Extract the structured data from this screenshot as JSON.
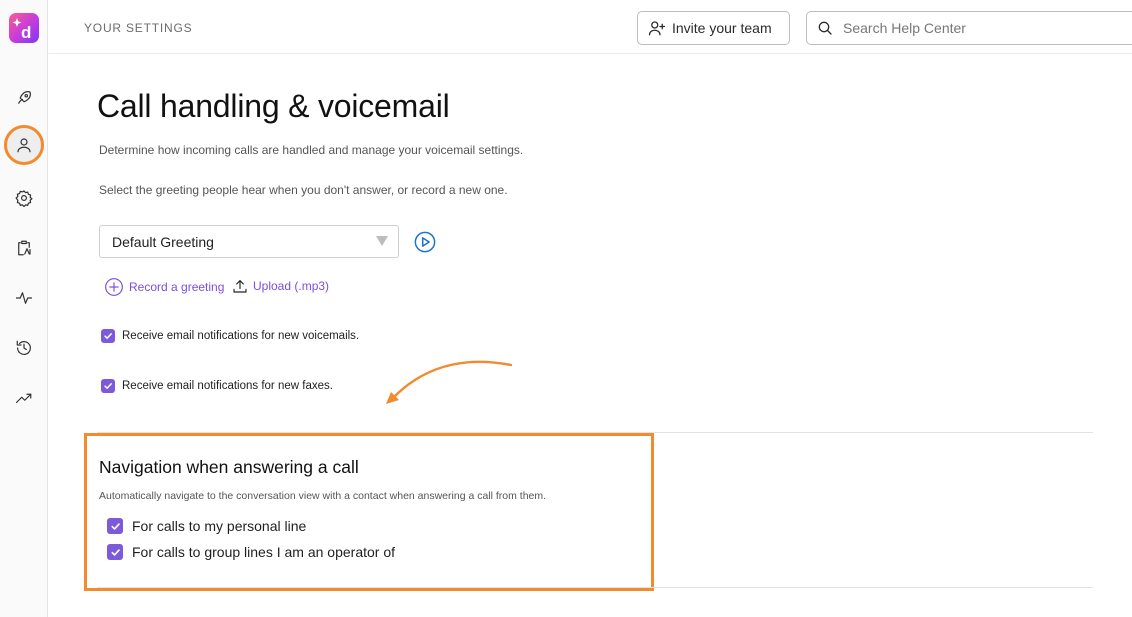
{
  "header": {
    "section_label": "YOUR SETTINGS",
    "invite_label": "Invite your team",
    "search_placeholder": "Search Help Center"
  },
  "sidebar": {
    "logo_icon": "dialpad-logo-icon",
    "items": [
      {
        "icon": "rocket-icon"
      },
      {
        "icon": "user-icon",
        "active": true
      },
      {
        "icon": "gear-icon"
      },
      {
        "icon": "clipboard-icon"
      },
      {
        "icon": "activity-pulse-icon"
      },
      {
        "icon": "history-icon"
      },
      {
        "icon": "trending-up-icon"
      }
    ]
  },
  "main": {
    "title": "Call handling & voicemail",
    "description": "Determine how incoming calls are handled and manage your voicemail settings.",
    "greeting_instruction": "Select the greeting people hear when you don't answer, or record a new one.",
    "greeting_select_value": "Default Greeting",
    "record_label": "Record a greeting",
    "upload_label": "Upload (.mp3)",
    "voicemail_email_label": "Receive email notifications for new voicemails.",
    "fax_email_label": "Receive email notifications for new faxes."
  },
  "navigation_section": {
    "title": "Navigation when answering a call",
    "description": "Automatically navigate to the conversation view with a contact when answering a call from them.",
    "personal_line_label": "For calls to my personal line",
    "group_lines_label": "For calls to group lines I am an operator of",
    "personal_line_checked": true,
    "group_lines_checked": true
  },
  "colors": {
    "accent_purple": "#7c5ad9",
    "highlight_orange": "#f28a2e",
    "play_blue": "#1a73c8"
  }
}
